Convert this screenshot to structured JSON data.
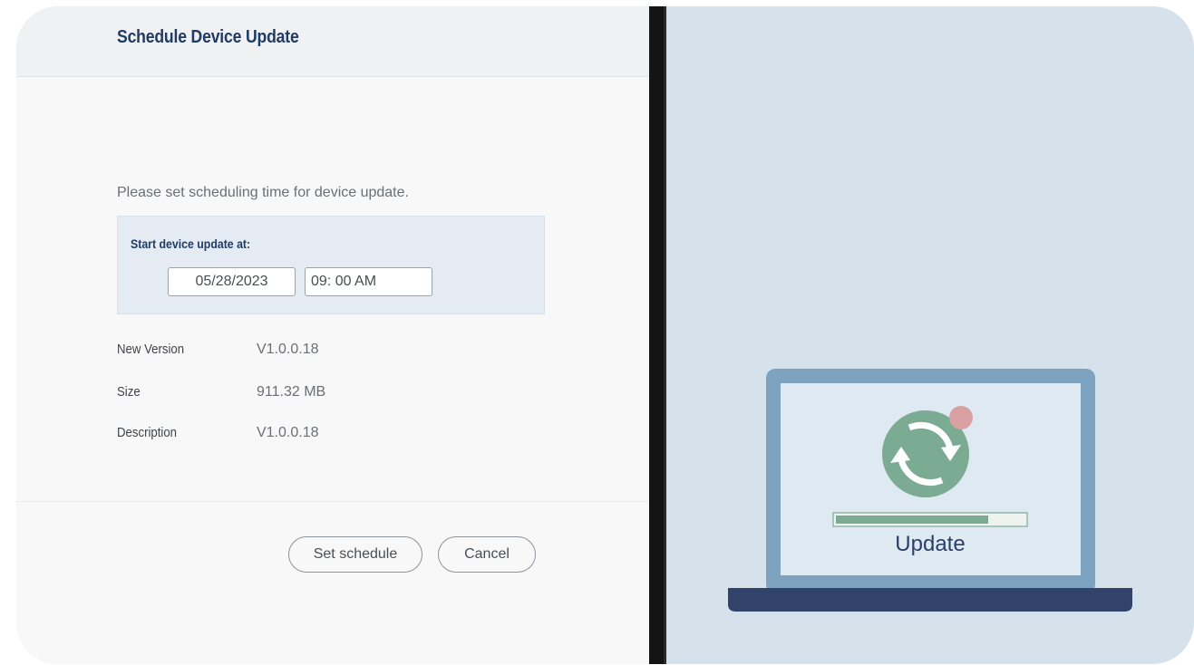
{
  "dialog": {
    "title": "Schedule Device Update",
    "instruction": "Please set scheduling time for device update.",
    "schedule": {
      "label": "Start device update at:",
      "date_value": "05/28/2023",
      "time_value": "09: 00 AM"
    },
    "info": [
      {
        "label": "New Version",
        "value": "V1.0.0.18"
      },
      {
        "label": "Size",
        "value": "911.32 MB"
      },
      {
        "label": "Description",
        "value": "V1.0.0.18"
      }
    ],
    "buttons": {
      "set_schedule": "Set schedule",
      "cancel": "Cancel"
    }
  },
  "illustration": {
    "screen_label": "Update",
    "progress": 0.81,
    "colors": {
      "background": "#d5e2eb",
      "laptop_frame": "#7ea3c1",
      "laptop_base": "#31426b",
      "screen": "#dfe9f1",
      "sync_circle": "#7bab93",
      "notification_dot": "#d8a0a0",
      "progress_fill": "#7bab93",
      "label_text": "#2a3f6a"
    },
    "icons": [
      "laptop-icon",
      "sync-icon",
      "notification-dot-icon"
    ]
  }
}
